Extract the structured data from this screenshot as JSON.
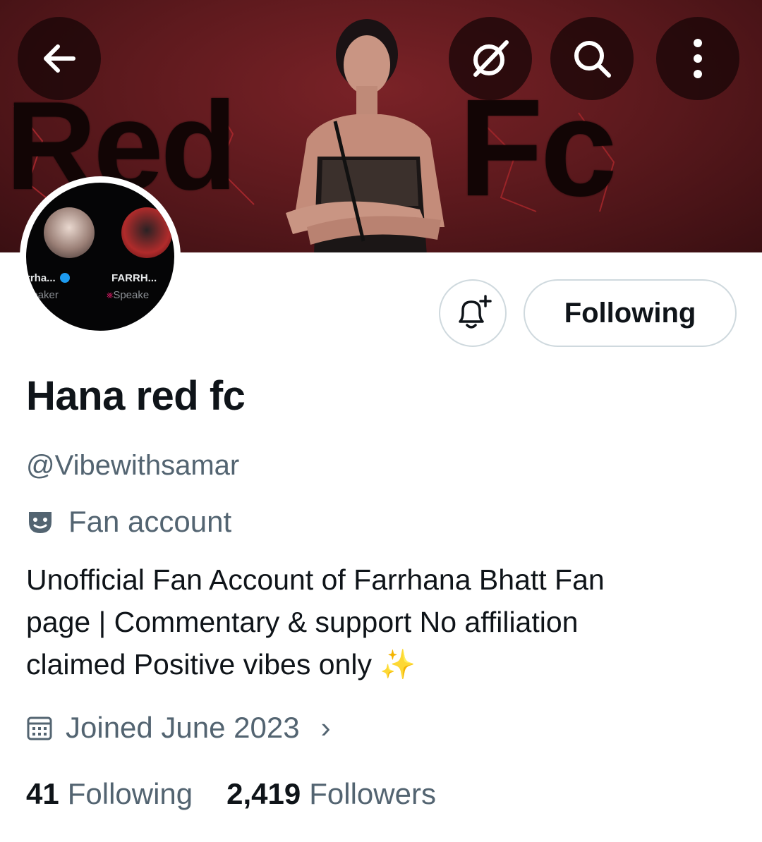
{
  "banner": {
    "text_left": "Red",
    "text_right": "Fc",
    "buttons": {
      "back_icon": "arrow-left-icon",
      "grok_icon": "grok-icon",
      "search_icon": "search-icon",
      "more_icon": "more-vertical-icon"
    }
  },
  "avatar": {
    "speaker1_name": "rrha...",
    "speaker1_role": "peaker",
    "speaker2_name": "FARRH...",
    "speaker2_role": "Speake"
  },
  "actions": {
    "notify_icon": "bell-plus-icon",
    "following_label": "Following"
  },
  "profile": {
    "display_name": "Hana red fc",
    "handle": "@Vibewithsamar",
    "category_icon": "theater-masks-icon",
    "category": "Fan account",
    "bio_lines": [
      "Unofficial Fan Account of Farrhana Bhatt Fan",
      "page | Commentary & support No affiliation",
      "claimed Positive vibes only"
    ],
    "bio_emoji": "✨",
    "joined_icon": "calendar-icon",
    "joined": "Joined June 2023",
    "joined_chevron": "›"
  },
  "stats": {
    "following_count": "41",
    "following_label": "Following",
    "followers_count": "2,419",
    "followers_label": "Followers"
  },
  "colors": {
    "banner_red": "#6b1d21",
    "text_primary": "#0f1419",
    "text_secondary": "#536471",
    "border": "#cfd9de",
    "verified": "#1d9bf0"
  }
}
